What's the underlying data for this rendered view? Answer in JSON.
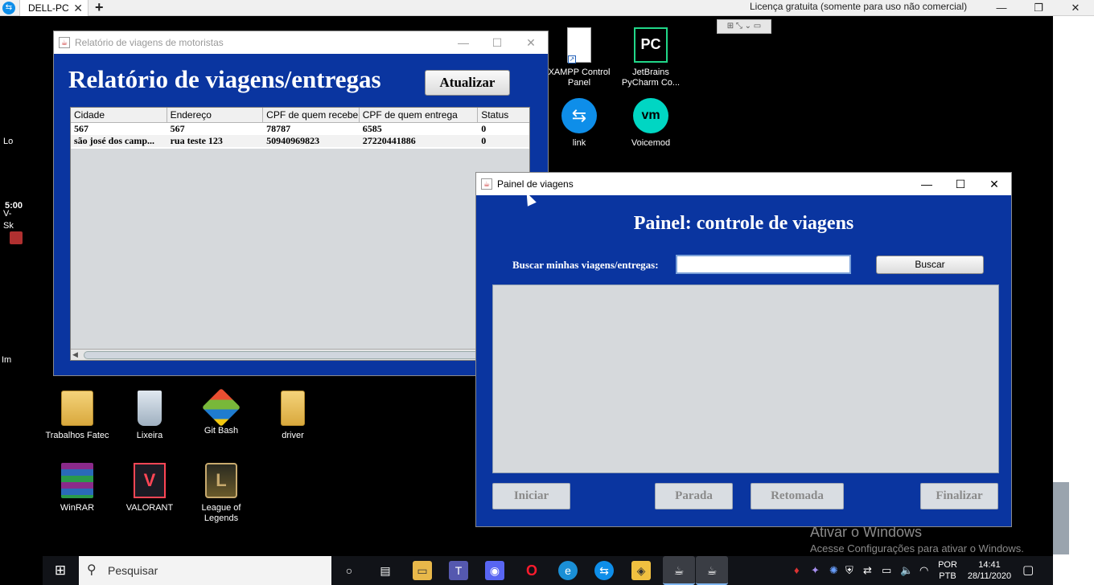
{
  "teamviewer": {
    "tab_label": "DELL-PC",
    "tab_close": "✕",
    "new_tab": "+",
    "license_text": "Licença gratuita (somente para uso não comercial)",
    "minimize": "—",
    "restore": "❐",
    "close": "✕"
  },
  "left_strip": {
    "clip_lo": "Lo",
    "time": "5:00",
    "clip_v": "V-",
    "clip_sk": "Sk",
    "clip_im": "Im"
  },
  "desktop_icons": {
    "xampp": "XAMPP Control Panel",
    "pycharm": "JetBrains PyCharm Co...",
    "pycharm_badge": "PC",
    "link": "link",
    "voicemod": "Voicemod",
    "trabalhos": "Trabalhos Fatec",
    "lixeira": "Lixeira",
    "gitbash": "Git Bash",
    "driver": "driver",
    "winrar": "WinRAR",
    "valorant": "VALORANT",
    "league": "League of Legends"
  },
  "relatorio_window": {
    "title": "Relatório de viagens de motoristas",
    "heading": "Relatório de viagens/entregas",
    "refresh_button": "Atualizar",
    "columns": [
      "Cidade",
      "Endereço",
      "CPF de quem recebe",
      "CPF de quem entrega",
      "Status"
    ],
    "rows": [
      [
        "567",
        "567",
        "78787",
        "6585",
        "0"
      ],
      [
        "são josé dos camp...",
        "rua teste 123",
        "50940969823",
        "27220441886",
        "0"
      ]
    ]
  },
  "painel_window": {
    "title": "Painel de viagens",
    "heading": "Painel: controle de viagens",
    "search_label": "Buscar minhas viagens/entregas:",
    "search_value": "",
    "search_button": "Buscar",
    "btn_iniciar": "Iniciar",
    "btn_parada": "Parada",
    "btn_retomada": "Retomada",
    "btn_finalizar": "Finalizar"
  },
  "activation": {
    "title": "Ativar o Windows",
    "subtitle": "Acesse Configurações para ativar o Windows."
  },
  "taskbar": {
    "search_placeholder": "Pesquisar",
    "lang_top": "POR",
    "lang_bottom": "PTB",
    "time": "14:41",
    "date": "28/11/2020"
  },
  "colors": {
    "java_blue": "#0a35a0",
    "desktop_bg": "#000000",
    "taskbar_bg": "#111318"
  }
}
